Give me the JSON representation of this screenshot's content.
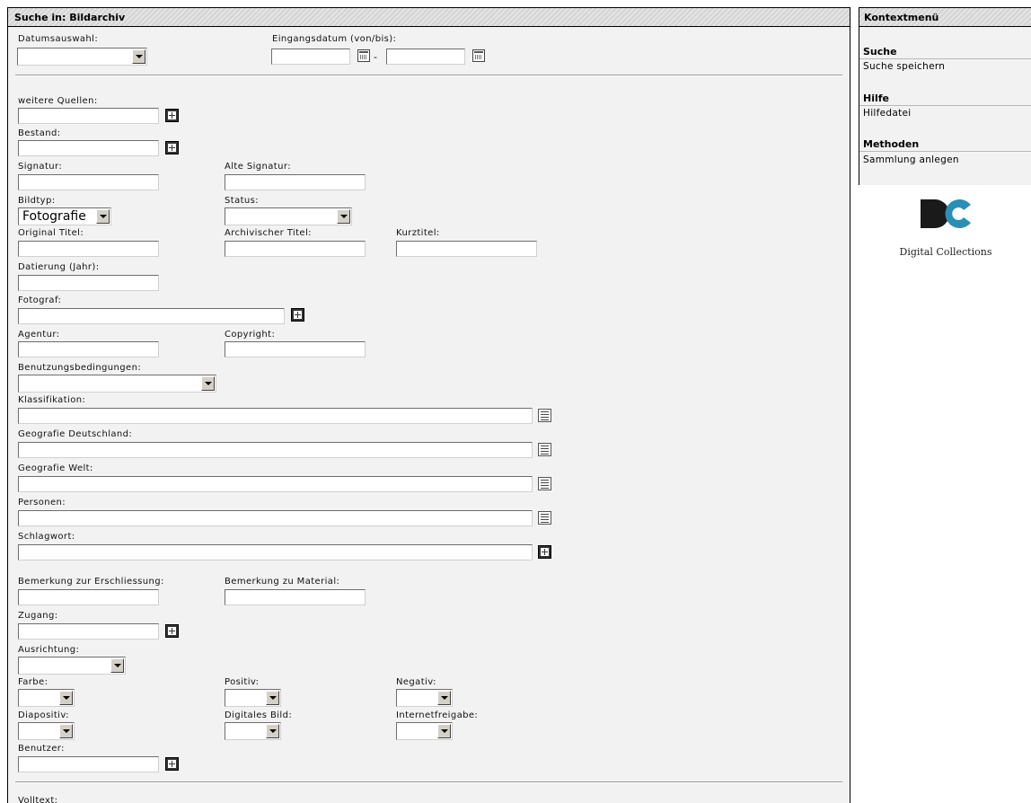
{
  "main": {
    "title": "Suche in: Bildarchiv",
    "labels": {
      "datumsauswahl": "Datumsauswahl:",
      "eingangsdatum": "Eingangsdatum (von/bis):",
      "date_separator": "-",
      "weitere_quellen": "weitere Quellen:",
      "bestand": "Bestand:",
      "signatur": "Signatur:",
      "alte_signatur": "Alte Signatur:",
      "bildtyp": "Bildtyp:",
      "status": "Status:",
      "original_titel": "Original Titel:",
      "archivischer_titel": "Archivischer Titel:",
      "kurztitel": "Kurztitel:",
      "datierung": "Datierung (Jahr):",
      "fotograf": "Fotograf:",
      "agentur": "Agentur:",
      "copyright": "Copyright:",
      "benutzungsbedingungen": "Benutzungsbedingungen:",
      "klassifikation": "Klassifikation:",
      "geografie_deutschland": "Geografie Deutschland:",
      "geografie_welt": "Geografie Welt:",
      "personen": "Personen:",
      "schlagwort": "Schlagwort:",
      "bemerkung_erschliessung": "Bemerkung zur Erschliessung:",
      "bemerkung_material": "Bemerkung zu Material:",
      "zugang": "Zugang:",
      "ausrichtung": "Ausrichtung:",
      "farbe": "Farbe:",
      "positiv": "Positiv:",
      "negativ": "Negativ:",
      "diapositiv": "Diapositiv:",
      "digitales_bild": "Digitales Bild:",
      "internetfreigabe": "Internetfreigabe:",
      "benutzer": "Benutzer:",
      "volltext": "Volltext:"
    },
    "values": {
      "bildtyp": "Fotografie"
    }
  },
  "sidebar": {
    "title": "Kontextmenü",
    "sections": [
      {
        "heading": "Suche",
        "item": "Suche speichern"
      },
      {
        "heading": "Hilfe",
        "item": "Hilfedatei"
      },
      {
        "heading": "Methoden",
        "item": "Sammlung anlegen"
      }
    ],
    "logo_text": "Digital Collections",
    "logo_colors": {
      "dark": "#1a1a1a",
      "accent": "#2a8fb5"
    }
  }
}
